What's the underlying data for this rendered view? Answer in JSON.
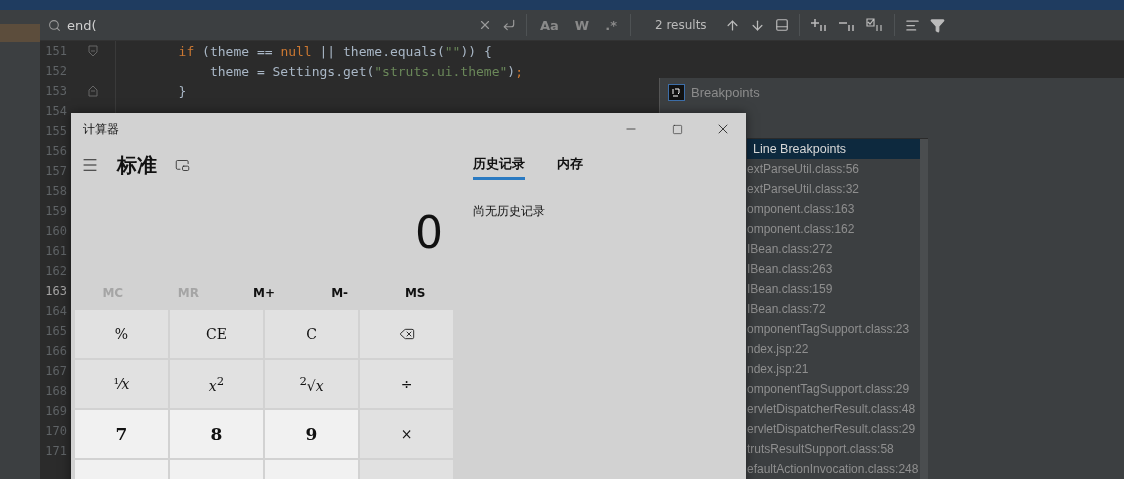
{
  "search_bar": {
    "value": "end(",
    "toggles": [
      "Aa",
      "W",
      ".*"
    ],
    "result_count": "2 results"
  },
  "editor": {
    "lines": [
      {
        "number": "151",
        "current": false,
        "kind": "fold_start",
        "tokens": [
          {
            "kind": "keyword",
            "text": "        if"
          },
          {
            "kind": "plain",
            "text": " (theme == "
          },
          {
            "kind": "keyword",
            "text": "null"
          },
          {
            "kind": "plain",
            "text": " || theme.equals("
          },
          {
            "kind": "string",
            "text": "\"\""
          },
          {
            "kind": "plain",
            "text": ")) {"
          }
        ]
      },
      {
        "number": "152",
        "current": false,
        "kind": "plain",
        "tokens": [
          {
            "kind": "plain",
            "text": "            theme = Settings.get("
          },
          {
            "kind": "string",
            "text": "\"struts.ui.theme\""
          },
          {
            "kind": "plain",
            "text": ")"
          },
          {
            "kind": "keyword",
            "text": ";"
          }
        ]
      },
      {
        "number": "153",
        "current": false,
        "kind": "fold_end",
        "tokens": [
          {
            "kind": "plain",
            "text": "        }"
          }
        ]
      },
      {
        "number": "154",
        "current": false,
        "kind": "plain"
      },
      {
        "number": "155",
        "current": false,
        "kind": "plain"
      },
      {
        "number": "156",
        "current": false,
        "kind": "plain"
      },
      {
        "number": "157",
        "current": false,
        "kind": "plain"
      },
      {
        "number": "158",
        "current": false,
        "kind": "plain"
      },
      {
        "number": "159",
        "current": false,
        "kind": "plain"
      },
      {
        "number": "160",
        "current": false,
        "kind": "plain"
      },
      {
        "number": "161",
        "current": false,
        "kind": "plain"
      },
      {
        "number": "162",
        "current": false,
        "kind": "plain"
      },
      {
        "number": "163",
        "current": true,
        "kind": "plain"
      },
      {
        "number": "164",
        "current": false,
        "kind": "plain"
      },
      {
        "number": "165",
        "current": false,
        "kind": "plain"
      },
      {
        "number": "166",
        "current": false,
        "kind": "plain"
      },
      {
        "number": "167",
        "current": false,
        "kind": "plain"
      },
      {
        "number": "168",
        "current": false,
        "kind": "plain"
      },
      {
        "number": "169",
        "current": false,
        "kind": "plain"
      },
      {
        "number": "170",
        "current": false,
        "kind": "plain"
      },
      {
        "number": "171",
        "current": false,
        "kind": "plain"
      }
    ]
  },
  "breakpoints": {
    "title": "Breakpoints",
    "header": {
      "label": "Line Breakpoints",
      "selected": true
    },
    "items": [
      "extParseUtil.class:56",
      "extParseUtil.class:32",
      "omponent.class:163",
      "omponent.class:162",
      "IBean.class:272",
      "IBean.class:263",
      "IBean.class:159",
      "IBean.class:72",
      "omponentTagSupport.class:23",
      "ndex.jsp:22",
      "ndex.jsp:21",
      "omponentTagSupport.class:29",
      "ervletDispatcherResult.class:48",
      "ervletDispatcherResult.class:29",
      "trutsResultSupport.class:58",
      "efaultActionInvocation.class:248"
    ]
  },
  "calculator": {
    "title": "计算器",
    "mode": "标准",
    "display": "0",
    "memory": [
      {
        "label": "MC",
        "disabled": true
      },
      {
        "label": "MR",
        "disabled": true
      },
      {
        "label": "M+",
        "disabled": false
      },
      {
        "label": "M-",
        "disabled": false
      },
      {
        "label": "MS",
        "disabled": false
      }
    ],
    "keys": [
      {
        "kind": "function",
        "label": "%"
      },
      {
        "kind": "function",
        "label": "CE"
      },
      {
        "kind": "function",
        "label": "C"
      },
      {
        "kind": "backspace"
      },
      {
        "kind": "function",
        "label": "¹⁄*x*"
      },
      {
        "kind": "function",
        "label": "*x*$^{2}$"
      },
      {
        "kind": "function",
        "label": "$^{2}$√*x*"
      },
      {
        "kind": "function",
        "label": "÷"
      },
      {
        "kind": "digit",
        "label": "7"
      },
      {
        "kind": "digit",
        "label": "8"
      },
      {
        "kind": "digit",
        "label": "9"
      },
      {
        "kind": "function",
        "label": "×"
      },
      {
        "kind": "digit"
      },
      {
        "kind": "digit"
      },
      {
        "kind": "digit"
      },
      {
        "kind": "function"
      }
    ],
    "tabs": [
      {
        "label": "历史记录",
        "selected": true
      },
      {
        "label": "内存",
        "selected": false
      }
    ],
    "empty_message": "尚无历史记录"
  }
}
